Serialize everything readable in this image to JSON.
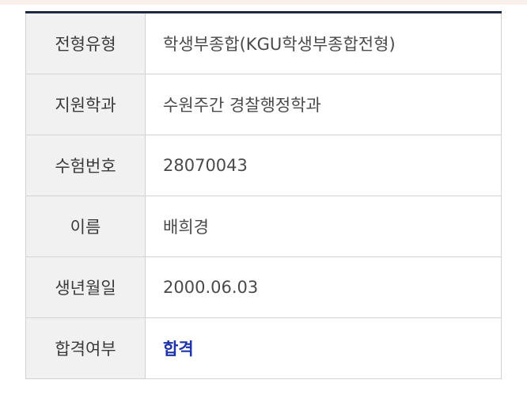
{
  "rows": [
    {
      "label": "전형유형",
      "value": "학생부종합(KGU학생부종합전형)"
    },
    {
      "label": "지원학과",
      "value": "수원주간 경찰행정학과"
    },
    {
      "label": "수험번호",
      "value": "28070043"
    },
    {
      "label": "이름",
      "value": "배희경"
    },
    {
      "label": "생년월일",
      "value": "2000.06.03"
    },
    {
      "label": "합격여부",
      "value": "합격"
    }
  ],
  "colors": {
    "header_border": "#1d2a44",
    "label_bg": "#f1f1f1",
    "pass_text": "#1f33a8"
  }
}
